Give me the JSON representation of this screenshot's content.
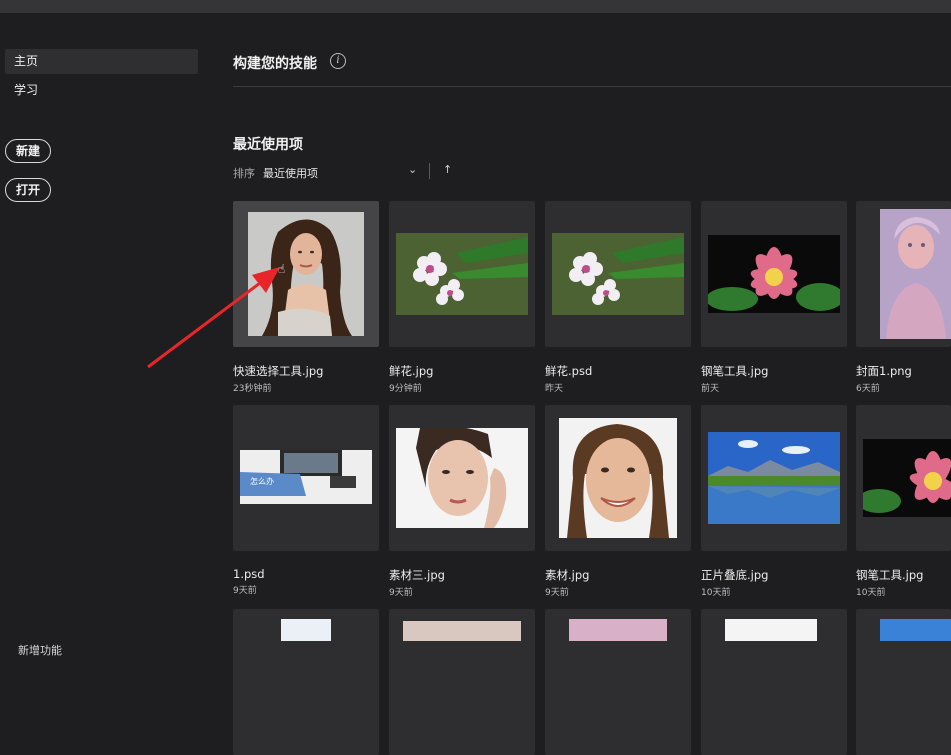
{
  "sidebar": {
    "items": [
      {
        "label": "主页"
      },
      {
        "label": "学习"
      }
    ],
    "new_label": "新建",
    "open_label": "打开",
    "whats_new_label": "新增功能"
  },
  "skills": {
    "title": "构建您的技能",
    "info_icon": "info-icon"
  },
  "recent": {
    "title": "最近使用项",
    "sort_label": "排序",
    "sort_value": "最近使用项",
    "files": [
      {
        "name": "快速选择工具.jpg",
        "time": "23秒钟前",
        "thumb": "portrait-woman"
      },
      {
        "name": "鲜花.jpg",
        "time": "9分钟前",
        "thumb": "white-flowers"
      },
      {
        "name": "鲜花.psd",
        "time": "昨天",
        "thumb": "white-flowers"
      },
      {
        "name": "钢笔工具.jpg",
        "time": "前天",
        "thumb": "lotus"
      },
      {
        "name": "封面1.png",
        "time": "6天前",
        "thumb": "pastel-portrait"
      },
      {
        "name": "1.psd",
        "time": "9天前",
        "thumb": "desk-banner",
        "thumb_text": "怎么办"
      },
      {
        "name": "素材三.jpg",
        "time": "9天前",
        "thumb": "face-closeup"
      },
      {
        "name": "素材.jpg",
        "time": "9天前",
        "thumb": "smiling-woman"
      },
      {
        "name": "正片叠底.jpg",
        "time": "10天前",
        "thumb": "lake-landscape"
      },
      {
        "name": "钢笔工具.jpg",
        "time": "10天前",
        "thumb": "lotus"
      }
    ]
  },
  "colors": {
    "background": "#1e1d1f",
    "card": "#2e2d30",
    "arrow": "#e8262a"
  }
}
